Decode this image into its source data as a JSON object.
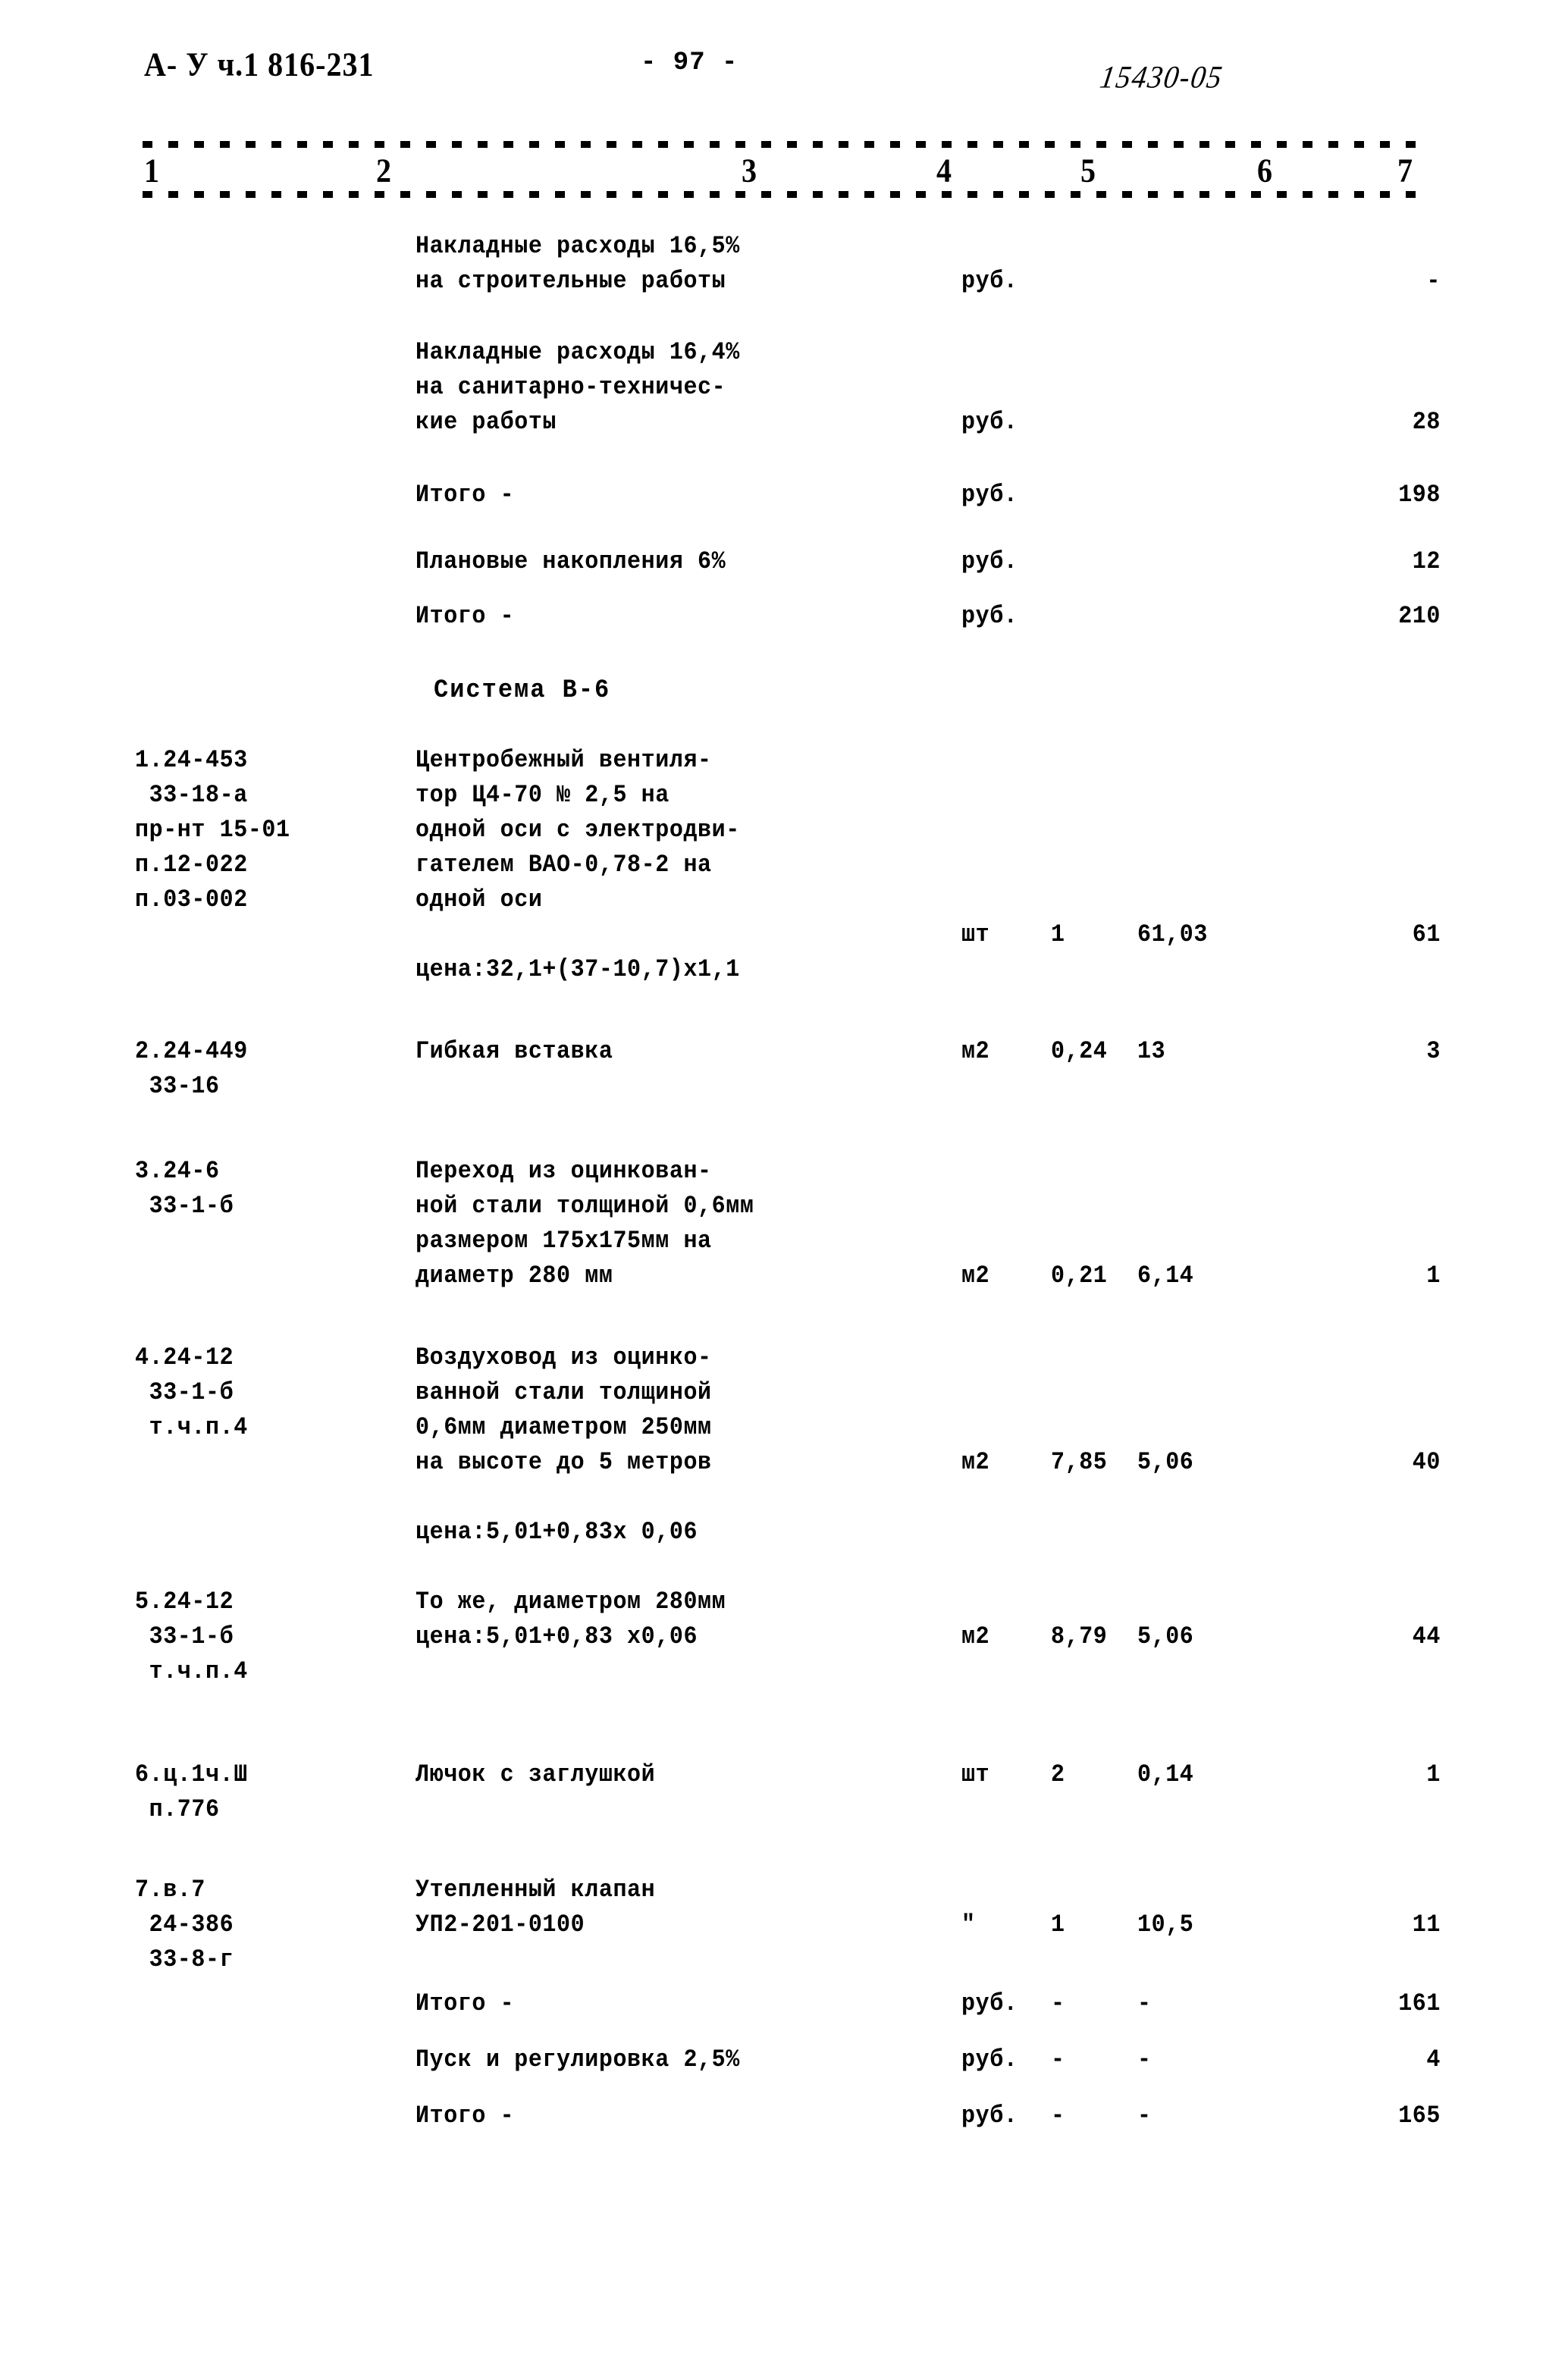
{
  "header": {
    "doc_code": "А- У ч.1 816-231",
    "page_number": "- 97 -",
    "stamp_number": "15430-05"
  },
  "column_numbers": [
    "1",
    "2",
    "3",
    "4",
    "5",
    "6",
    "7"
  ],
  "section": {
    "title": "Система В-6"
  },
  "rows": [
    {
      "code": "",
      "desc_lines": [
        "Накладные расходы 16,5%",
        "на строительные работы"
      ],
      "unit": "руб.",
      "qty": "",
      "price": "",
      "total": "-"
    },
    {
      "code": "",
      "desc_lines": [
        "Накладные расходы 16,4%",
        "на санитарно-техничес-",
        "кие работы"
      ],
      "unit": "руб.",
      "qty": "",
      "price": "",
      "total": "28"
    },
    {
      "code": "",
      "desc_lines": [
        "Итого -"
      ],
      "unit": "руб.",
      "qty": "",
      "price": "",
      "total": "198"
    },
    {
      "code": "",
      "desc_lines": [
        "Плановые накопления 6%"
      ],
      "unit": "руб.",
      "qty": "",
      "price": "",
      "total": "12"
    },
    {
      "code": "",
      "desc_lines": [
        "Итого -"
      ],
      "unit": "руб.",
      "qty": "",
      "price": "",
      "total": "210"
    },
    {
      "code_lines": [
        "1.24-453",
        " 33-18-а",
        "пр-нт 15-01",
        "п.12-022",
        "п.03-002"
      ],
      "desc_lines": [
        "Центробежный вентиля-",
        "тор Ц4-70 № 2,5 на",
        "одной оси с электродви-",
        "гателем ВАО-0,78-2 на",
        "одной оси"
      ],
      "note": "цена:32,1+(37-10,7)х1,1",
      "unit": "шт",
      "qty": "1",
      "price": "61,03",
      "total": "61"
    },
    {
      "code_lines": [
        "2.24-449",
        " 33-16"
      ],
      "desc_lines": [
        "Гибкая вставка"
      ],
      "unit": "м2",
      "qty": "0,24",
      "price": "13",
      "total": "3"
    },
    {
      "code_lines": [
        "3.24-6",
        " 33-1-б"
      ],
      "desc_lines": [
        "Переход из оцинкован-",
        "ной стали толщиной 0,6мм",
        "размером 175х175мм на",
        "диаметр 280 мм"
      ],
      "unit": "м2",
      "qty": "0,21",
      "price": "6,14",
      "total": "1"
    },
    {
      "code_lines": [
        "4.24-12",
        " 33-1-б",
        " т.ч.п.4"
      ],
      "desc_lines": [
        "Воздуховод из оцинко-",
        "ванной стали толщиной",
        "0,6мм диаметром 250мм",
        "на высоте до 5 метров"
      ],
      "note": "цена:5,01+0,83х 0,06",
      "unit": "м2",
      "qty": "7,85",
      "price": "5,06",
      "total": "40"
    },
    {
      "code_lines": [
        "5.24-12",
        " 33-1-б",
        " т.ч.п.4"
      ],
      "desc_lines": [
        "То же, диаметром 280мм",
        "цена:5,01+0,83 х0,06"
      ],
      "unit": "м2",
      "qty": "8,79",
      "price": "5,06",
      "total": "44"
    },
    {
      "code_lines": [
        "6.ц.1ч.Ш",
        " п.776"
      ],
      "desc_lines": [
        "Лючок с заглушкой"
      ],
      "unit": "шт",
      "qty": "2",
      "price": "0,14",
      "total": "1"
    },
    {
      "code_lines": [
        "7.в.7",
        " 24-386",
        " 33-8-г"
      ],
      "desc_lines": [
        "Утепленный клапан",
        "УП2-201-0100"
      ],
      "unit": "\"",
      "qty": "1",
      "price": "10,5",
      "total": "11"
    },
    {
      "code": "",
      "desc_lines": [
        "Итого -"
      ],
      "unit": "руб.",
      "qty": "-",
      "price": "-",
      "total": "161"
    },
    {
      "code": "",
      "desc_lines": [
        "Пуск и регулировка 2,5%"
      ],
      "unit": "руб.",
      "qty": "-",
      "price": "-",
      "total": "4"
    },
    {
      "code": "",
      "desc_lines": [
        "Итого -"
      ],
      "unit": "руб.",
      "qty": "-",
      "price": "-",
      "total": "165"
    }
  ]
}
